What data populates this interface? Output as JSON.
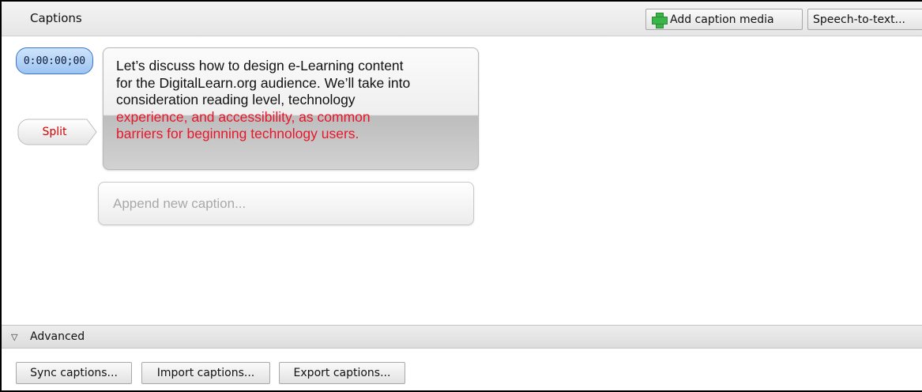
{
  "panel": {
    "title": "Captions"
  },
  "toolbar": {
    "add_caption_media": "Add caption media",
    "add_caption_media_icon": "plus-icon",
    "speech_to_text": "Speech-to-text..."
  },
  "caption": {
    "timestamp": "0:00:00;00",
    "split_label": "Split",
    "lines_black": [
      "Let’s discuss how to design e-Learning content",
      "for the DigitalLearn.org audience. We’ll take into",
      "consideration reading level, technology"
    ],
    "lines_red": [
      "experience, and accessibility, as common",
      "barriers for beginning technology users."
    ]
  },
  "append": {
    "placeholder": "Append new caption..."
  },
  "advanced": {
    "label": "Advanced",
    "toggle_icon": "triangle-down-icon",
    "buttons": {
      "sync": "Sync captions...",
      "import": "Import captions...",
      "export": "Export captions..."
    }
  },
  "colors": {
    "highlight_text": "#e8162a",
    "split_text": "#d40000",
    "timestamp_bg": "#9cc4f2",
    "timestamp_border": "#3b74c8",
    "plus_icon": "#3ab54a"
  }
}
